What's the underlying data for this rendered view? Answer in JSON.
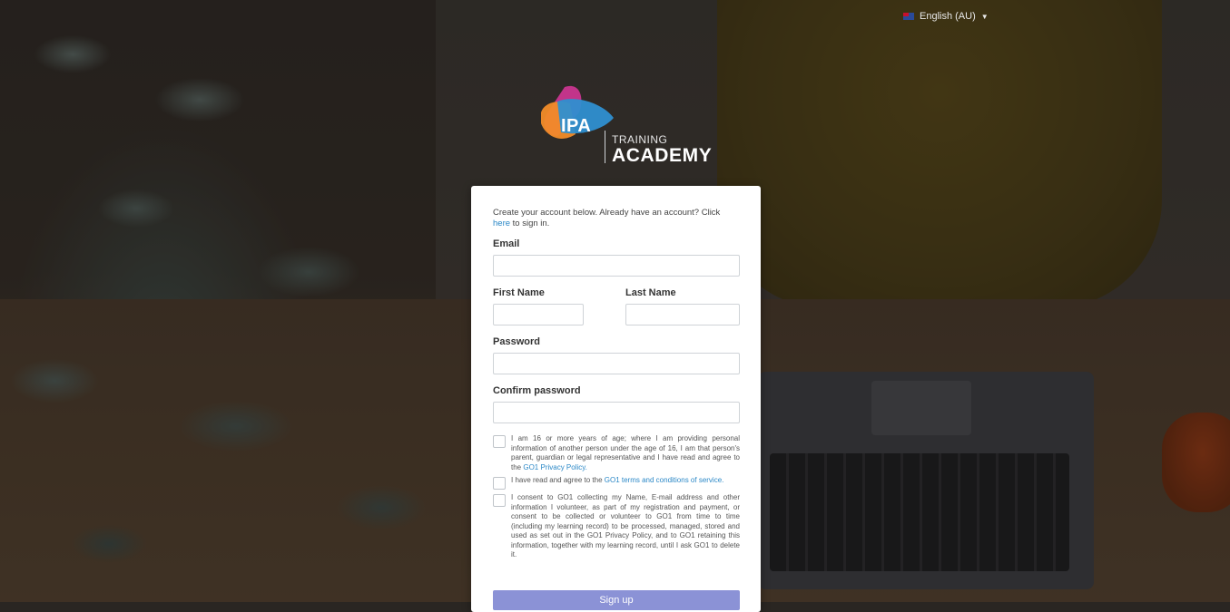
{
  "header": {
    "language": "English (AU)",
    "language_flag_icon": "australia-flag-icon"
  },
  "logo": {
    "mark_text": "IPA",
    "line1": "TRAINING",
    "line2": "ACADEMY"
  },
  "form": {
    "intro_prefix": "Create your account below. Already have an account? Click",
    "intro_link": "here",
    "intro_suffix": "to sign in.",
    "email_label": "Email",
    "first_name_label": "First Name",
    "last_name_label": "Last Name",
    "password_label": "Password",
    "confirm_password_label": "Confirm password",
    "email_value": "",
    "first_name_value": "",
    "last_name_value": "",
    "password_value": "",
    "confirm_password_value": "",
    "consent_age_text": "I am 16 or more years of age; where I am providing personal information of another person under the age of 16, I am that person's parent, guardian or legal representative and I have read and agree to the",
    "consent_age_link": "GO1 Privacy Policy.",
    "consent_terms_text": "I have read and agree to the",
    "consent_terms_link": "GO1 terms and conditions of service.",
    "consent_data_text": "I consent to GO1 collecting my Name, E-mail address and other information I volunteer, as part of my registration and payment, or consent to be collected or volunteer to GO1 from time to time (including my learning record) to be processed, managed, stored and used as set out in the GO1 Privacy Policy, and to GO1 retaining this information, together with my learning record, until I ask GO1 to delete it.",
    "signup_label": "Sign up"
  },
  "colors": {
    "link": "#2b88c7",
    "signup_button": "#8b92d6",
    "logo_orange": "#f28c28",
    "logo_magenta": "#c2348a",
    "logo_blue": "#2f8fd0"
  }
}
